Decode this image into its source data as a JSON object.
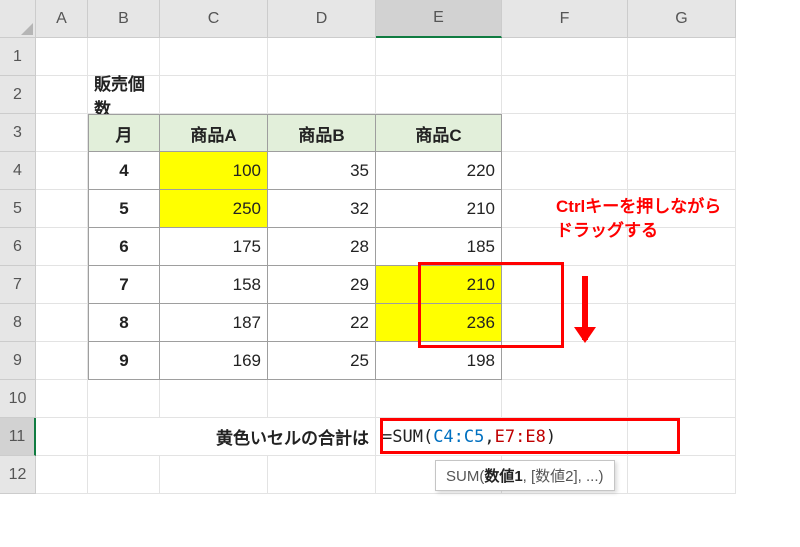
{
  "columns": [
    "A",
    "B",
    "C",
    "D",
    "E",
    "F",
    "G"
  ],
  "rows": [
    1,
    2,
    3,
    4,
    5,
    6,
    7,
    8,
    9,
    10,
    11,
    12
  ],
  "active_col": "E",
  "active_row": 11,
  "title_cell": "販売個数",
  "headers": {
    "month": "月",
    "a": "商品A",
    "b": "商品B",
    "c": "商品C"
  },
  "data": [
    {
      "m": 4,
      "a": 100,
      "b": 35,
      "c": 220
    },
    {
      "m": 5,
      "a": 250,
      "b": 32,
      "c": 210
    },
    {
      "m": 6,
      "a": 175,
      "b": 28,
      "c": 185
    },
    {
      "m": 7,
      "a": 158,
      "b": 29,
      "c": 210
    },
    {
      "m": 8,
      "a": 187,
      "b": 22,
      "c": 236
    },
    {
      "m": 9,
      "a": 169,
      "b": 25,
      "c": 198
    }
  ],
  "sum_label": "黄色いセルの合計は",
  "formula": {
    "pre": "=SUM(",
    "arg1": "C4:C5",
    "comma": ",",
    "arg2": "E7:E8",
    "post": ")"
  },
  "tooltip": {
    "func": "SUM(",
    "b1": "数値1",
    "rest": ", [数値2], ...)"
  },
  "annotation": {
    "line1": "Ctrlキーを押しながら",
    "line2": "ドラッグする"
  },
  "chart_data": {
    "type": "table",
    "title": "販売個数",
    "categories": [
      "商品A",
      "商品B",
      "商品C"
    ],
    "x": [
      4,
      5,
      6,
      7,
      8,
      9
    ],
    "series": [
      {
        "name": "商品A",
        "values": [
          100,
          250,
          175,
          158,
          187,
          169
        ]
      },
      {
        "name": "商品B",
        "values": [
          35,
          32,
          28,
          29,
          22,
          25
        ]
      },
      {
        "name": "商品C",
        "values": [
          220,
          210,
          185,
          210,
          236,
          198
        ]
      }
    ],
    "highlighted_ranges": [
      "C4:C5",
      "E7:E8"
    ],
    "formula": "=SUM(C4:C5,E7:E8)"
  }
}
